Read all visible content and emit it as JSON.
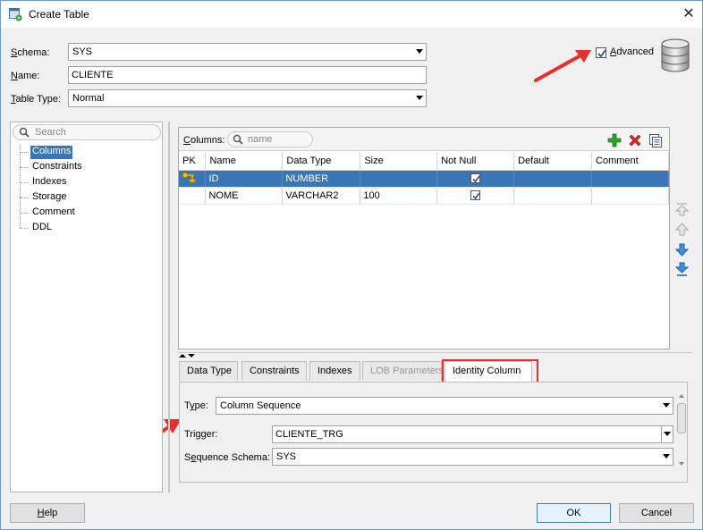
{
  "window": {
    "title": "Create Table"
  },
  "form": {
    "schema_label": "Schema:",
    "schema_value": "SYS",
    "name_label": "Name:",
    "name_value": "CLIENTE",
    "table_type_label": "Table Type:",
    "table_type_value": "Normal",
    "advanced_label": "Advanced",
    "advanced_checked": true
  },
  "sidebar": {
    "search_placeholder": "Search",
    "items": [
      {
        "label": "Columns",
        "selected": true
      },
      {
        "label": "Constraints"
      },
      {
        "label": "Indexes"
      },
      {
        "label": "Storage"
      },
      {
        "label": "Comment"
      },
      {
        "label": "DDL"
      }
    ]
  },
  "columns_panel": {
    "label": "Columns:",
    "filter_placeholder": "name",
    "toolbar_icons": [
      "add-column-icon",
      "delete-column-icon",
      "copy-column-icon"
    ],
    "headers": [
      "PK",
      "Name",
      "Data Type",
      "Size",
      "Not Null",
      "Default",
      "Comment"
    ],
    "rows": [
      {
        "pk": true,
        "name": "ID",
        "data_type": "NUMBER",
        "size": "",
        "not_null": true,
        "default": "",
        "comment": ""
      },
      {
        "pk": false,
        "name": "NOME",
        "data_type": "VARCHAR2",
        "size": "100",
        "not_null": true,
        "default": "",
        "comment": ""
      }
    ]
  },
  "side_buttons": [
    "move-top-icon",
    "move-up-icon",
    "move-down-icon",
    "move-bottom-icon"
  ],
  "tabs": [
    {
      "label": "Data Type"
    },
    {
      "label": "Constraints"
    },
    {
      "label": "Indexes"
    },
    {
      "label": "LOB Parameters",
      "disabled": true
    },
    {
      "label": "Identity Column",
      "active": true
    }
  ],
  "identity": {
    "type_label": "Type:",
    "type_value": "Column Sequence",
    "trigger_label": "Trigger:",
    "trigger_value": "CLIENTE_TRG",
    "seq_schema_label": "Sequence Schema:",
    "seq_schema_value": "SYS"
  },
  "footer": {
    "help": "Help",
    "ok": "OK",
    "cancel": "Cancel"
  },
  "colors": {
    "selection": "#3a76b6",
    "highlight": "#e4302f",
    "add_green": "#2ea12e",
    "delete_red": "#d62828"
  }
}
